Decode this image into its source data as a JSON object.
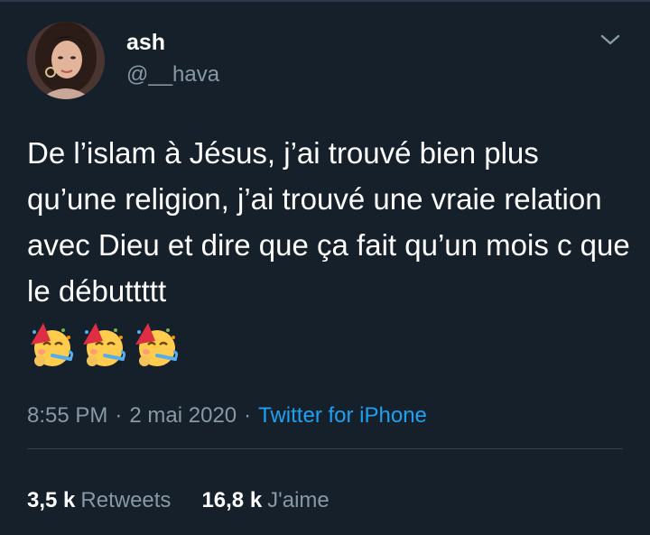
{
  "author": {
    "name": "ash",
    "handle": "@__hava"
  },
  "tweet": {
    "text": "De l’islam à Jésus, j’ai trouvé bien plus qu’une religion, j’ai trouvé une vraie relation avec Dieu et dire que ça fait qu’un mois c que le débuttttt",
    "emojis": [
      "🥳",
      "🥳",
      "🥳"
    ]
  },
  "meta": {
    "time": "8:55 PM",
    "date": "2 mai 2020",
    "separator": "·",
    "source": "Twitter for iPhone"
  },
  "stats": {
    "retweets_count": "3,5 k",
    "retweets_label": "Retweets",
    "likes_count": "16,8 k",
    "likes_label": "J'aime"
  },
  "colors": {
    "background": "#15202b",
    "text_primary": "#ffffff",
    "text_secondary": "#8899a6",
    "link": "#1da1f2",
    "divider": "#38444d"
  },
  "icons": {
    "menu": "chevron-down-icon",
    "emoji": "partying-face-emoji"
  }
}
